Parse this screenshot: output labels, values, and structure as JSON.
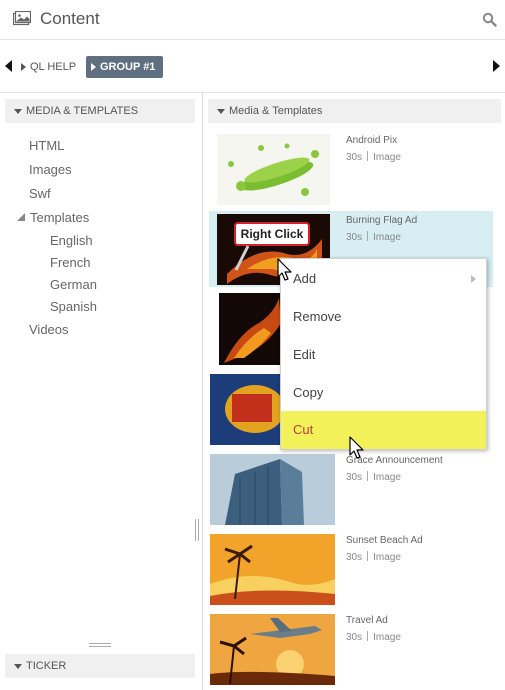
{
  "header": {
    "title": "Content",
    "icon": "image-icon",
    "search_icon": "search-icon"
  },
  "breadcrumb": {
    "help_label": "QL HELP",
    "group_label": "GROUP #1"
  },
  "left_panel": {
    "header": "MEDIA & TEMPLATES",
    "items": [
      "HTML",
      "Images",
      "Swf"
    ],
    "templates": {
      "label": "Templates",
      "children": [
        "English",
        "French",
        "German",
        "Spanish"
      ]
    },
    "videos": "Videos",
    "bottom_header": "TICKER"
  },
  "right_panel": {
    "header": "Media & Templates",
    "items": [
      {
        "title": "Android Pix",
        "duration": "30s",
        "type": "Image"
      },
      {
        "title": "Burning Flag Ad",
        "duration": "30s",
        "type": "Image"
      },
      {
        "title": "",
        "duration": "",
        "type": ""
      },
      {
        "title": "",
        "duration": "",
        "type": ""
      },
      {
        "title": "Grace Announcement",
        "duration": "30s",
        "type": "Image"
      },
      {
        "title": "Sunset Beach Ad",
        "duration": "30s",
        "type": "Image"
      },
      {
        "title": "Travel Ad",
        "duration": "30s",
        "type": "Image"
      }
    ]
  },
  "context_menu": {
    "items": [
      "Add",
      "Remove",
      "Edit",
      "Copy",
      "Cut"
    ]
  },
  "annotation": {
    "right_click": "Right Click"
  },
  "colors": {
    "highlight": "#f2f15a",
    "selected_row": "#d7eef2",
    "group_badge": "#5f6f7f",
    "callout_border": "#d3222a"
  }
}
